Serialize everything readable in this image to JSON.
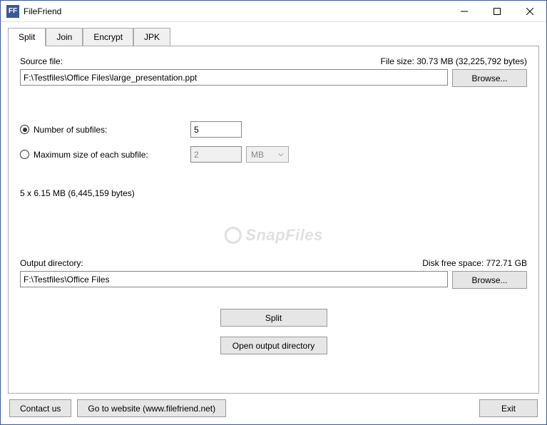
{
  "app": {
    "title": "FileFriend",
    "icon_text": "FF"
  },
  "tabs": [
    {
      "label": "Split"
    },
    {
      "label": "Join"
    },
    {
      "label": "Encrypt"
    },
    {
      "label": "JPK"
    }
  ],
  "split": {
    "source_label": "Source file:",
    "filesize_label": "File size: 30.73 MB (32,225,792 bytes)",
    "source_value": "F:\\Testfiles\\Office Files\\large_presentation.ppt",
    "browse_label": "Browse...",
    "radio_subfiles_label": "Number of subfiles:",
    "subfiles_value": "5",
    "radio_maxsize_label": "Maximum size of each subfile:",
    "maxsize_value": "2",
    "maxsize_unit": "MB",
    "calc_label": "5 x 6.15 MB (6,445,159 bytes)",
    "output_label": "Output directory:",
    "disk_free_label": "Disk free space: 772.71 GB",
    "output_value": "F:\\Testfiles\\Office Files",
    "split_btn": "Split",
    "open_output_btn": "Open output directory"
  },
  "footer": {
    "contact": "Contact us",
    "website": "Go to website (www.filefriend.net)",
    "exit": "Exit"
  },
  "watermark": "SnapFiles"
}
